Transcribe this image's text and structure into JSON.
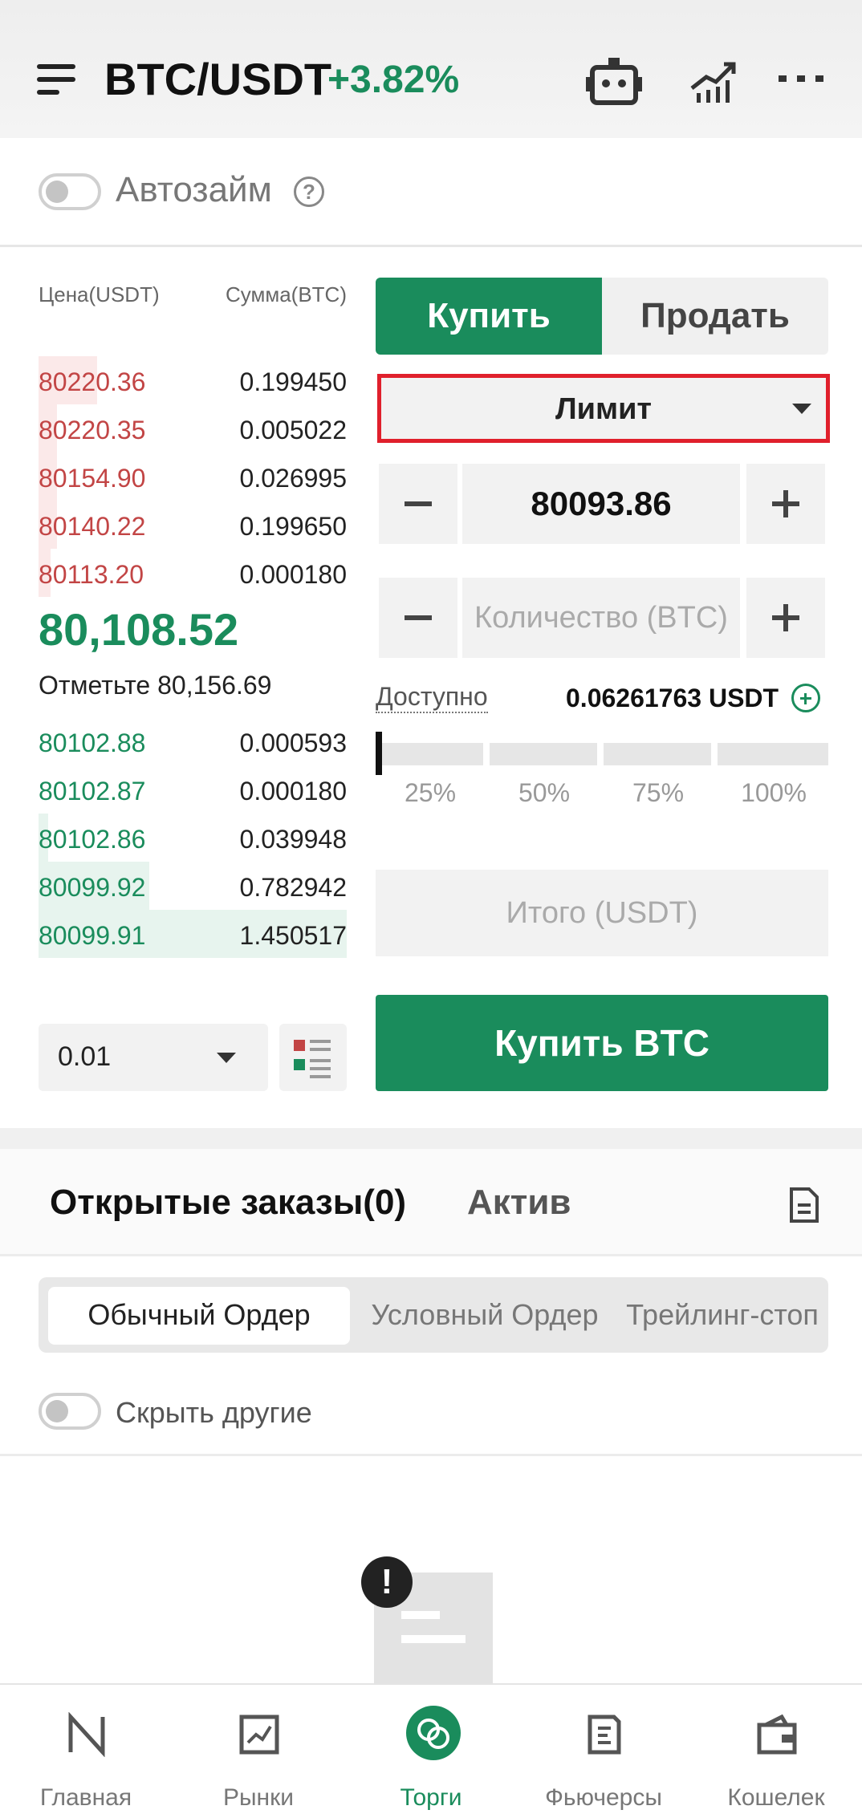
{
  "header": {
    "pair": "BTC/USDT",
    "change": "+3.82%"
  },
  "autozaim": {
    "label": "Автозайм",
    "help": "?"
  },
  "orderbook": {
    "price_header": "Цена(USDT)",
    "amount_header": "Сумма(BTC)",
    "asks": [
      {
        "price": "80220.36",
        "amount": "0.199450",
        "depth": 0.19
      },
      {
        "price": "80220.35",
        "amount": "0.005022",
        "depth": 0.06
      },
      {
        "price": "80154.90",
        "amount": "0.026995",
        "depth": 0.06
      },
      {
        "price": "80140.22",
        "amount": "0.199650",
        "depth": 0.06
      },
      {
        "price": "80113.20",
        "amount": "0.000180",
        "depth": 0.04
      }
    ],
    "last_price": "80,108.52",
    "mark_price": "Отметьте 80,156.69",
    "bids": [
      {
        "price": "80102.88",
        "amount": "0.000593",
        "depth": 0.0
      },
      {
        "price": "80102.87",
        "amount": "0.000180",
        "depth": 0.0
      },
      {
        "price": "80102.86",
        "amount": "0.039948",
        "depth": 0.03
      },
      {
        "price": "80099.92",
        "amount": "0.782942",
        "depth": 0.36
      },
      {
        "price": "80099.91",
        "amount": "1.450517",
        "depth": 1.0
      }
    ],
    "step_value": "0.01"
  },
  "trade": {
    "buy_tab": "Купить",
    "sell_tab": "Продать",
    "order_type": "Лимит",
    "price_value": "80093.86",
    "quantity_placeholder": "Количество (BTC)",
    "available_label": "Доступно",
    "available_value": "0.06261763 USDT",
    "slider_value_percent": 0,
    "percent_labels": [
      "25%",
      "50%",
      "75%",
      "100%"
    ],
    "total_placeholder": "Итого (USDT)",
    "buy_button": "Купить BTC"
  },
  "orders": {
    "title": "Открытые заказы(0)",
    "asset_tab": "Актив",
    "segments": [
      "Обычный Ордер",
      "Условный Ордер",
      "Трейлинг-стоп"
    ],
    "hide_others": "Скрыть другие"
  },
  "nav": {
    "items": [
      {
        "label": "Главная",
        "icon": "home-logo-icon"
      },
      {
        "label": "Рынки",
        "icon": "markets-chart-icon"
      },
      {
        "label": "Торги",
        "icon": "trade-icon"
      },
      {
        "label": "Фьючерсы",
        "icon": "futures-icon"
      },
      {
        "label": "Кошелек",
        "icon": "wallet-icon"
      }
    ]
  },
  "colors": {
    "green": "#1a8c5c",
    "red": "#c24545",
    "highlight": "#e0202c"
  }
}
